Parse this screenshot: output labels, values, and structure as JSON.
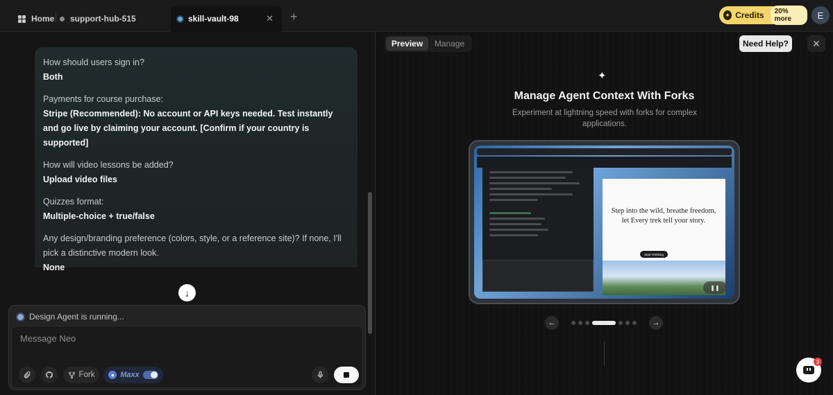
{
  "tabs": {
    "home": "Home",
    "support_hub": "support-hub-515",
    "active": "skill-vault-98"
  },
  "credits": {
    "label": "Credits",
    "promo": "20% more"
  },
  "user": {
    "initial": "E"
  },
  "chat": {
    "messages": [
      {
        "q": "How should users sign in?",
        "a": "Both"
      },
      {
        "q": "Payments for course purchase:",
        "a": "Stripe (Recommended): No account or API keys needed. Test instantly and go live by claiming your account. [Confirm if your country is supported]"
      },
      {
        "q": "How will video lessons be added?",
        "a": "Upload video files"
      },
      {
        "q": "Quizzes format:",
        "a": "Multiple-choice + true/false"
      },
      {
        "q": "Any design/branding preference (colors, style, or a reference site)? If none, I'll pick a distinctive modern look.",
        "a": "None"
      }
    ]
  },
  "composer": {
    "status": "Design Agent is running...",
    "placeholder": "Message Neo",
    "fork_label": "Fork",
    "maxx_label": "Maxx"
  },
  "preview": {
    "tab_preview": "Preview",
    "tab_manage": "Manage",
    "help_label": "Need Help?",
    "feature_title": "Manage Agent Context With Forks",
    "feature_subtitle": "Experiment at lightning speed with forks for complex applications.",
    "mockup_headline": "Step into the wild, breathe freedom, let Every trek tell your story.",
    "mockup_cta": "Start Trekking"
  },
  "carousel": {
    "total": 7,
    "active": 3
  },
  "support": {
    "badge_count": "3"
  },
  "colors": {
    "accent_credits": "#f6d56b",
    "chat_bubble": "#1f2b2c",
    "background": "#121212"
  }
}
